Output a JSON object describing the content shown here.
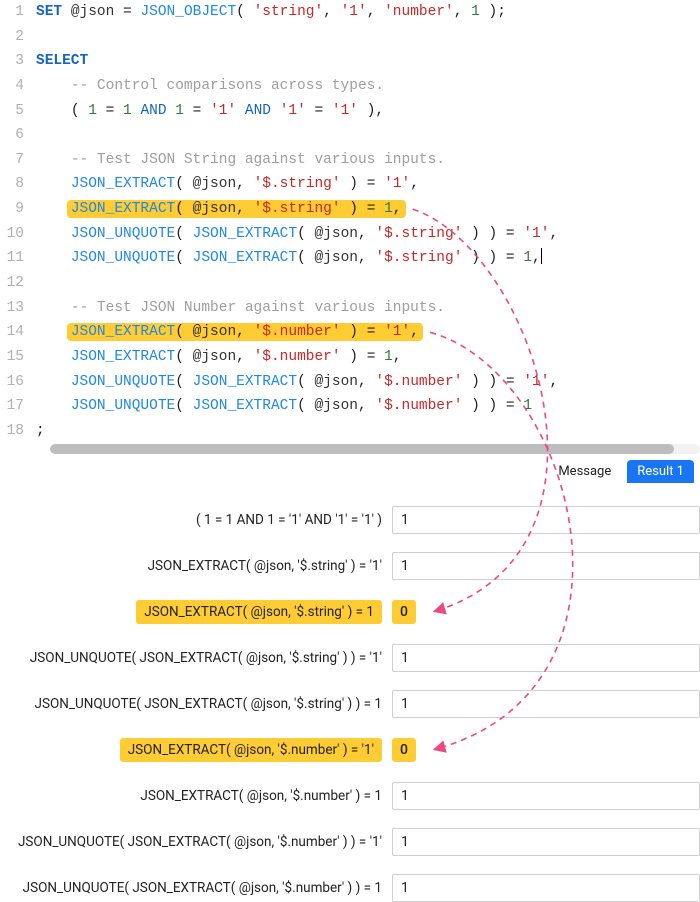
{
  "colors": {
    "highlight": "#ffcc33",
    "arrow": "#e84a82"
  },
  "code": {
    "lines": [
      {
        "n": 1,
        "prefix": "",
        "content": [
          [
            "kw",
            "SET"
          ],
          [
            "sp",
            " "
          ],
          [
            "at",
            "@json"
          ],
          [
            "sp",
            " "
          ],
          [
            "op",
            "="
          ],
          [
            "sp",
            " "
          ],
          [
            "fn",
            "JSON_OBJECT"
          ],
          [
            "paren",
            "( "
          ],
          [
            "str",
            "'string'"
          ],
          [
            "op",
            ", "
          ],
          [
            "str",
            "'1'"
          ],
          [
            "op",
            ", "
          ],
          [
            "str",
            "'number'"
          ],
          [
            "op",
            ", "
          ],
          [
            "num",
            "1"
          ],
          [
            "paren",
            " )"
          ],
          [
            "op",
            ";"
          ]
        ]
      },
      {
        "n": 2,
        "blank": true
      },
      {
        "n": 3,
        "content": [
          [
            "kw",
            "SELECT"
          ]
        ]
      },
      {
        "n": 4,
        "indent": 1,
        "content": [
          [
            "comment",
            "-- Control comparisons across types."
          ]
        ]
      },
      {
        "n": 5,
        "indent": 1,
        "content": [
          [
            "paren",
            "( "
          ],
          [
            "num",
            "1"
          ],
          [
            "sp",
            " "
          ],
          [
            "op",
            "="
          ],
          [
            "sp",
            " "
          ],
          [
            "num",
            "1"
          ],
          [
            "sp",
            " "
          ],
          [
            "kwl",
            "AND"
          ],
          [
            "sp",
            " "
          ],
          [
            "num",
            "1"
          ],
          [
            "sp",
            " "
          ],
          [
            "op",
            "="
          ],
          [
            "sp",
            " "
          ],
          [
            "str",
            "'1'"
          ],
          [
            "sp",
            " "
          ],
          [
            "kwl",
            "AND"
          ],
          [
            "sp",
            " "
          ],
          [
            "str",
            "'1'"
          ],
          [
            "sp",
            " "
          ],
          [
            "op",
            "="
          ],
          [
            "sp",
            " "
          ],
          [
            "str",
            "'1'"
          ],
          [
            "paren",
            " )"
          ],
          [
            "op",
            ","
          ]
        ]
      },
      {
        "n": 6,
        "blank": true
      },
      {
        "n": 7,
        "indent": 1,
        "content": [
          [
            "comment",
            "-- Test JSON String against various inputs."
          ]
        ]
      },
      {
        "n": 8,
        "indent": 1,
        "content": [
          [
            "fn",
            "JSON_EXTRACT"
          ],
          [
            "paren",
            "( "
          ],
          [
            "at",
            "@json"
          ],
          [
            "op",
            ", "
          ],
          [
            "str",
            "'$.string'"
          ],
          [
            "paren",
            " )"
          ],
          [
            "sp",
            " "
          ],
          [
            "op",
            "="
          ],
          [
            "sp",
            " "
          ],
          [
            "str",
            "'1'"
          ],
          [
            "op",
            ","
          ]
        ]
      },
      {
        "n": 9,
        "indent": 1,
        "hl": true,
        "content": [
          [
            "fn",
            "JSON_EXTRACT"
          ],
          [
            "paren",
            "( "
          ],
          [
            "at",
            "@json"
          ],
          [
            "op",
            ", "
          ],
          [
            "str",
            "'$.string'"
          ],
          [
            "paren",
            " )"
          ],
          [
            "sp",
            " "
          ],
          [
            "op",
            "="
          ],
          [
            "sp",
            " "
          ],
          [
            "num",
            "1"
          ],
          [
            "op",
            ","
          ]
        ]
      },
      {
        "n": 10,
        "indent": 1,
        "content": [
          [
            "fn",
            "JSON_UNQUOTE"
          ],
          [
            "paren",
            "( "
          ],
          [
            "fn",
            "JSON_EXTRACT"
          ],
          [
            "paren",
            "( "
          ],
          [
            "at",
            "@json"
          ],
          [
            "op",
            ", "
          ],
          [
            "str",
            "'$.string'"
          ],
          [
            "paren",
            " )"
          ],
          [
            "paren",
            " )"
          ],
          [
            "sp",
            " "
          ],
          [
            "op",
            "="
          ],
          [
            "sp",
            " "
          ],
          [
            "str",
            "'1'"
          ],
          [
            "op",
            ","
          ]
        ]
      },
      {
        "n": 11,
        "indent": 1,
        "content": [
          [
            "fn",
            "JSON_UNQUOTE"
          ],
          [
            "paren",
            "( "
          ],
          [
            "fn",
            "JSON_EXTRACT"
          ],
          [
            "paren",
            "( "
          ],
          [
            "at",
            "@json"
          ],
          [
            "op",
            ", "
          ],
          [
            "str",
            "'$.string'"
          ],
          [
            "paren",
            " )"
          ],
          [
            "paren",
            " )"
          ],
          [
            "sp",
            " "
          ],
          [
            "op",
            "="
          ],
          [
            "sp",
            " "
          ],
          [
            "num",
            "1"
          ],
          [
            "op",
            ","
          ]
        ],
        "cursor": true
      },
      {
        "n": 12,
        "blank": true
      },
      {
        "n": 13,
        "indent": 1,
        "content": [
          [
            "comment",
            "-- Test JSON Number against various inputs."
          ]
        ]
      },
      {
        "n": 14,
        "indent": 1,
        "hl": true,
        "content": [
          [
            "fn",
            "JSON_EXTRACT"
          ],
          [
            "paren",
            "( "
          ],
          [
            "at",
            "@json"
          ],
          [
            "op",
            ", "
          ],
          [
            "str",
            "'$.number'"
          ],
          [
            "paren",
            " )"
          ],
          [
            "sp",
            " "
          ],
          [
            "op",
            "="
          ],
          [
            "sp",
            " "
          ],
          [
            "str",
            "'1'"
          ],
          [
            "op",
            ","
          ]
        ]
      },
      {
        "n": 15,
        "indent": 1,
        "content": [
          [
            "fn",
            "JSON_EXTRACT"
          ],
          [
            "paren",
            "( "
          ],
          [
            "at",
            "@json"
          ],
          [
            "op",
            ", "
          ],
          [
            "str",
            "'$.number'"
          ],
          [
            "paren",
            " )"
          ],
          [
            "sp",
            " "
          ],
          [
            "op",
            "="
          ],
          [
            "sp",
            " "
          ],
          [
            "num",
            "1"
          ],
          [
            "op",
            ","
          ]
        ]
      },
      {
        "n": 16,
        "indent": 1,
        "content": [
          [
            "fn",
            "JSON_UNQUOTE"
          ],
          [
            "paren",
            "( "
          ],
          [
            "fn",
            "JSON_EXTRACT"
          ],
          [
            "paren",
            "( "
          ],
          [
            "at",
            "@json"
          ],
          [
            "op",
            ", "
          ],
          [
            "str",
            "'$.number'"
          ],
          [
            "paren",
            " )"
          ],
          [
            "paren",
            " )"
          ],
          [
            "sp",
            " "
          ],
          [
            "op",
            "="
          ],
          [
            "sp",
            " "
          ],
          [
            "str",
            "'1'"
          ],
          [
            "op",
            ","
          ]
        ]
      },
      {
        "n": 17,
        "indent": 1,
        "content": [
          [
            "fn",
            "JSON_UNQUOTE"
          ],
          [
            "paren",
            "( "
          ],
          [
            "fn",
            "JSON_EXTRACT"
          ],
          [
            "paren",
            "( "
          ],
          [
            "at",
            "@json"
          ],
          [
            "op",
            ", "
          ],
          [
            "str",
            "'$.number'"
          ],
          [
            "paren",
            " )"
          ],
          [
            "paren",
            " )"
          ],
          [
            "sp",
            " "
          ],
          [
            "op",
            "="
          ],
          [
            "sp",
            " "
          ],
          [
            "num",
            "1"
          ]
        ]
      },
      {
        "n": 18,
        "content": [
          [
            "op",
            ";"
          ]
        ]
      }
    ]
  },
  "tabs": {
    "message": "Message",
    "result": "Result 1"
  },
  "results": [
    {
      "label": "( 1 = 1 AND 1 = '1' AND '1' = '1' )",
      "value": "1",
      "hl": false
    },
    {
      "label": "JSON_EXTRACT( @json, '$.string' ) = '1'",
      "value": "1",
      "hl": false
    },
    {
      "label": "JSON_EXTRACT( @json, '$.string' ) = 1",
      "value": "0",
      "hl": true
    },
    {
      "label": "JSON_UNQUOTE( JSON_EXTRACT( @json, '$.string' ) ) = '1'",
      "value": "1",
      "hl": false
    },
    {
      "label": "JSON_UNQUOTE( JSON_EXTRACT( @json, '$.string' ) ) = 1",
      "value": "1",
      "hl": false
    },
    {
      "label": "JSON_EXTRACT( @json, '$.number' ) = '1'",
      "value": "0",
      "hl": true
    },
    {
      "label": "JSON_EXTRACT( @json, '$.number' ) = 1",
      "value": "1",
      "hl": false
    },
    {
      "label": "JSON_UNQUOTE( JSON_EXTRACT( @json, '$.number' ) ) = '1'",
      "value": "1",
      "hl": false
    },
    {
      "label": "JSON_UNQUOTE( JSON_EXTRACT( @json, '$.number' ) ) = 1",
      "value": "1",
      "hl": false
    }
  ]
}
